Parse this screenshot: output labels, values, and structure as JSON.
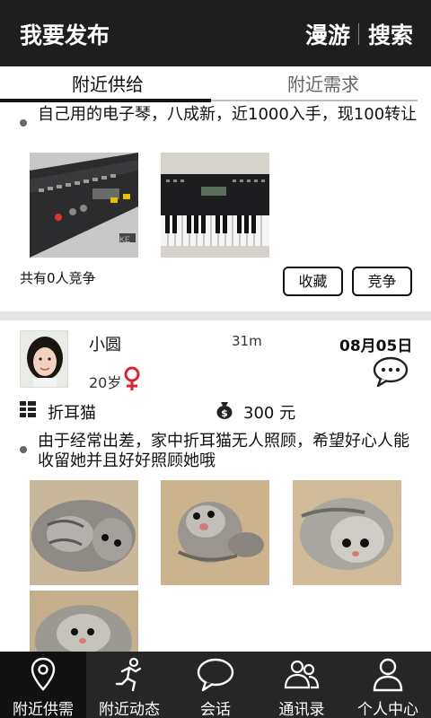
{
  "header": {
    "title": "我要发布",
    "roam": "漫游",
    "search": "搜索"
  },
  "tabs": [
    {
      "label": "附近供给",
      "active": true
    },
    {
      "label": "附近需求",
      "active": false
    }
  ],
  "post1": {
    "text": "自己用的电子琴，八成新，近1000入手，现100转让",
    "competitor_count": "共有0人竞争",
    "favorite_button": "收藏",
    "compete_button": "竞争"
  },
  "post2": {
    "user_name": "小圆",
    "distance": "31m",
    "date": "08月05日",
    "age": "20岁",
    "category": "折耳猫",
    "price": "300 元",
    "text": "由于经常出差，家中折耳猫无人照顾，希望好心人能收留她并且好好照顾她哦"
  },
  "bottom_nav": [
    {
      "label": "附近供需",
      "icon": "location-pin-icon",
      "active": true
    },
    {
      "label": "附近动态",
      "icon": "running-person-icon",
      "active": false
    },
    {
      "label": "会话",
      "icon": "chat-bubble-icon",
      "active": false
    },
    {
      "label": "通讯录",
      "icon": "contacts-icon",
      "active": false
    },
    {
      "label": "个人中心",
      "icon": "person-icon",
      "active": false
    }
  ],
  "colors": {
    "header_bg": "#1e1e1e",
    "nav_bg": "#262626",
    "gender_female": "#d9252b"
  }
}
